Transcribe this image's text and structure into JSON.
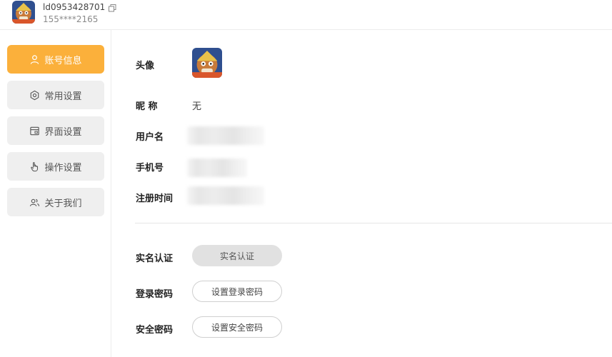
{
  "user": {
    "id": "ld0953428701",
    "phone": "155****2165"
  },
  "sidebar": {
    "items": [
      {
        "label": "账号信息",
        "icon": "user-icon",
        "active": true
      },
      {
        "label": "常用设置",
        "icon": "gear-icon",
        "active": false
      },
      {
        "label": "界面设置",
        "icon": "window-icon",
        "active": false
      },
      {
        "label": "操作设置",
        "icon": "hand-pointer-icon",
        "active": false
      },
      {
        "label": "关于我们",
        "icon": "users-icon",
        "active": false
      }
    ]
  },
  "profile": {
    "avatar_label": "头像",
    "nickname_label": "昵 称",
    "nickname_value": "无",
    "username_label": "用户名",
    "phone_label": "手机号",
    "register_time_label": "注册时间"
  },
  "security": {
    "realname_label": "实名认证",
    "realname_button": "实名认证",
    "login_password_label": "登录密码",
    "login_password_button": "设置登录密码",
    "safe_password_label": "安全密码",
    "safe_password_button": "设置安全密码"
  },
  "colors": {
    "accent": "#fbb03b",
    "nav_bg": "#efefef",
    "divider": "#ececec"
  }
}
